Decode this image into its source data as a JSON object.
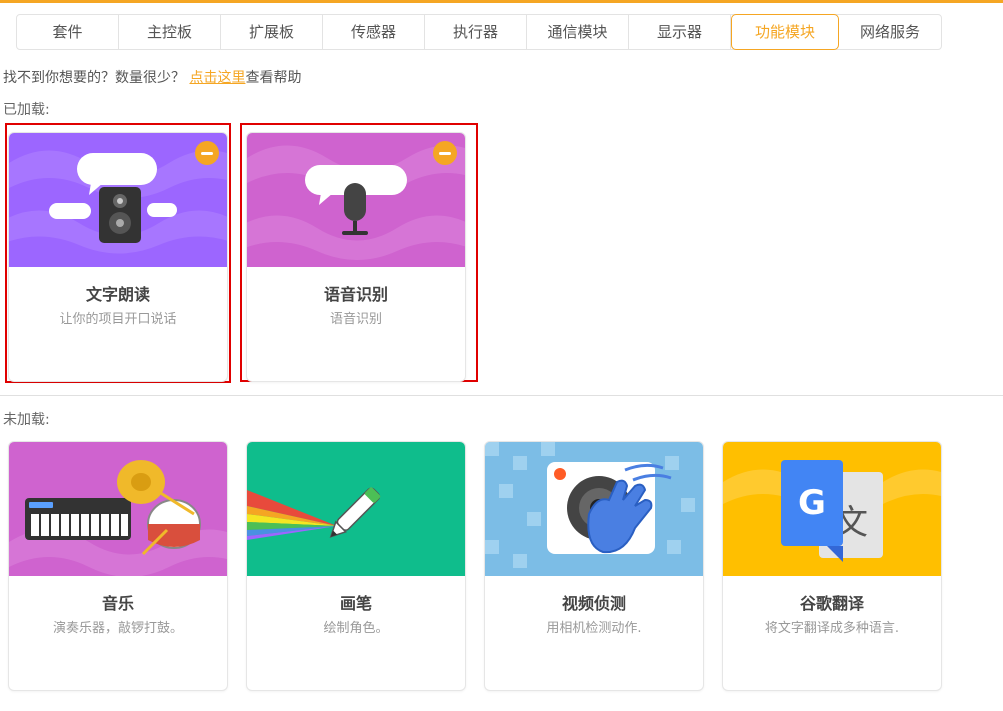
{
  "tabs": [
    {
      "label": "套件"
    },
    {
      "label": "主控板"
    },
    {
      "label": "扩展板"
    },
    {
      "label": "传感器"
    },
    {
      "label": "执行器"
    },
    {
      "label": "通信模块"
    },
    {
      "label": "显示器"
    },
    {
      "label": "功能模块",
      "active": true
    },
    {
      "label": "网络服务"
    }
  ],
  "help": {
    "prefix": "找不到你想要的？数量很少？",
    "link": "点击这里",
    "suffix": "查看帮助"
  },
  "loaded": {
    "label": "已加载:",
    "cards": [
      {
        "title": "文字朗读",
        "desc": "让你的项目开口说话",
        "icon": "speaker-icon"
      },
      {
        "title": "语音识别",
        "desc": "语音识别",
        "icon": "microphone-icon"
      }
    ]
  },
  "unloaded": {
    "label": "未加载:",
    "cards": [
      {
        "title": "音乐",
        "desc": "演奏乐器，敲锣打鼓。",
        "icon": "music-instruments-icon"
      },
      {
        "title": "画笔",
        "desc": "绘制角色。",
        "icon": "pen-icon"
      },
      {
        "title": "视频侦测",
        "desc": "用相机检测动作.",
        "icon": "video-sensing-icon"
      },
      {
        "title": "谷歌翻译",
        "desc": "将文字翻译成多种语言.",
        "icon": "google-translate-icon"
      }
    ]
  },
  "colors": {
    "accent": "#f5a623",
    "highlight": "#e00000"
  }
}
